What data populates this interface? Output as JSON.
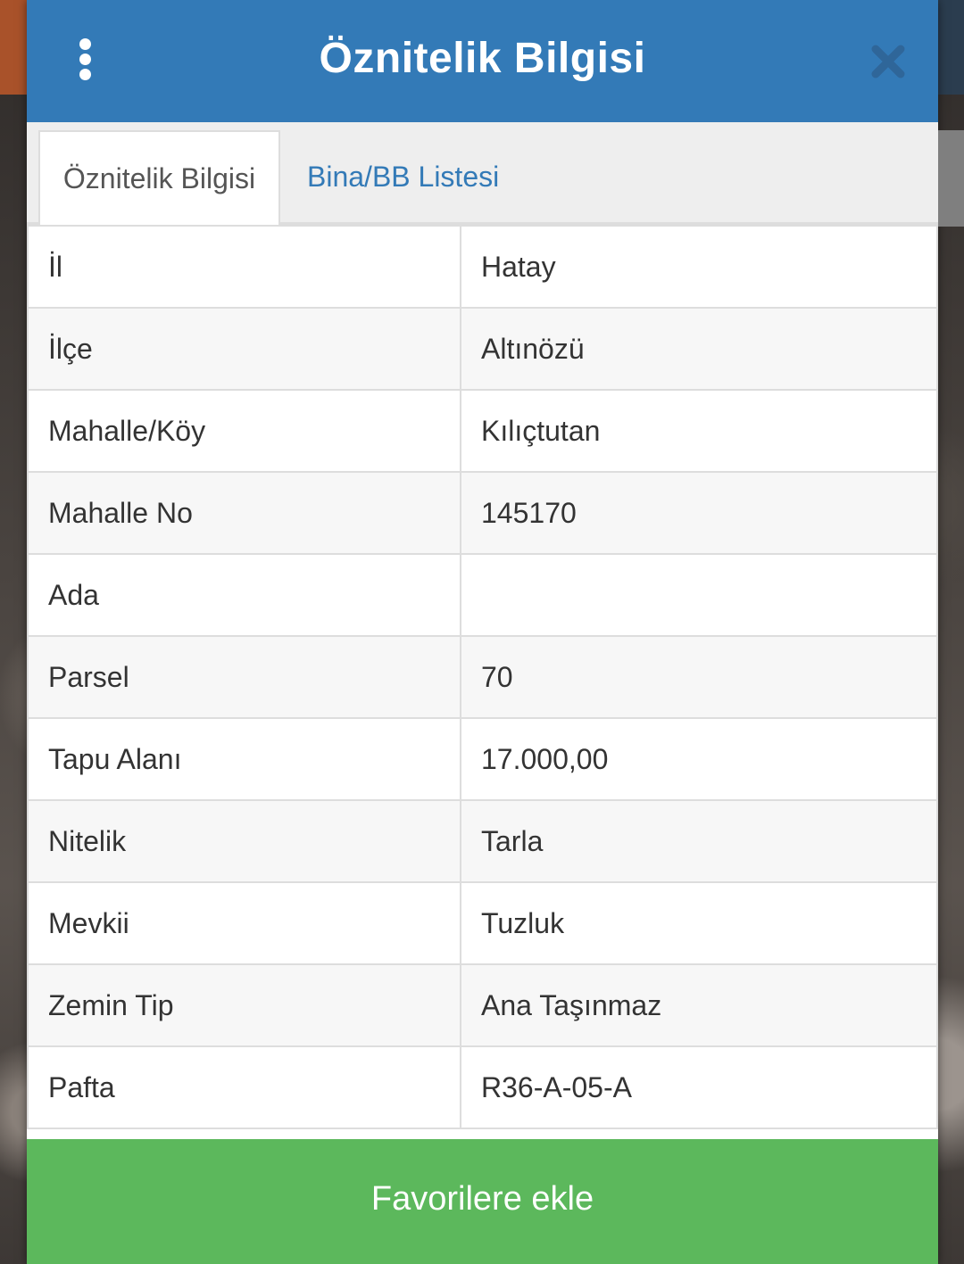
{
  "header": {
    "title": "Öznitelik Bilgisi",
    "menu_icon": "more-vertical-icon",
    "close_icon": "close-icon"
  },
  "tabs": [
    {
      "label": "Öznitelik Bilgisi",
      "active": true
    },
    {
      "label": "Bina/BB Listesi",
      "active": false
    }
  ],
  "attributes": [
    {
      "label": "İl",
      "value": "Hatay"
    },
    {
      "label": "İlçe",
      "value": "Altınözü"
    },
    {
      "label": "Mahalle/Köy",
      "value": "Kılıçtutan"
    },
    {
      "label": "Mahalle No",
      "value": "145170"
    },
    {
      "label": "Ada",
      "value": ""
    },
    {
      "label": "Parsel",
      "value": "70"
    },
    {
      "label": "Tapu Alanı",
      "value": "17.000,00"
    },
    {
      "label": "Nitelik",
      "value": "Tarla"
    },
    {
      "label": "Mevkii",
      "value": "Tuzluk"
    },
    {
      "label": "Zemin Tip",
      "value": "Ana Taşınmaz"
    },
    {
      "label": "Pafta",
      "value": "R36-A-05-A"
    }
  ],
  "footer": {
    "favorite_label": "Favorilere ekle"
  },
  "colors": {
    "header": "#337ab7",
    "tab_link": "#337ab7",
    "favorite_button": "#5cb85c",
    "close_icon": "#2f6699"
  }
}
